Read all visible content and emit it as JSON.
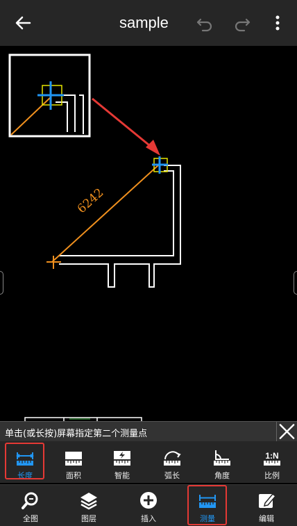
{
  "header": {
    "title": "sample"
  },
  "drawing": {
    "dimension_label": "6242"
  },
  "hint": {
    "text": "单击(或长按)屏幕指定第二个测量点"
  },
  "measure_tools": [
    {
      "label": "长度",
      "active": true
    },
    {
      "label": "面积"
    },
    {
      "label": "智能"
    },
    {
      "label": "弧长"
    },
    {
      "label": "角度"
    },
    {
      "label": "比例",
      "icon_text": "1:N"
    }
  ],
  "bottom_tabs": [
    {
      "label": "全图"
    },
    {
      "label": "图层"
    },
    {
      "label": "插入"
    },
    {
      "label": "测量",
      "active": true
    },
    {
      "label": "编辑"
    }
  ],
  "colors": {
    "accent": "#2196f3",
    "dimension": "#f0901e",
    "highlight": "#e53935"
  }
}
